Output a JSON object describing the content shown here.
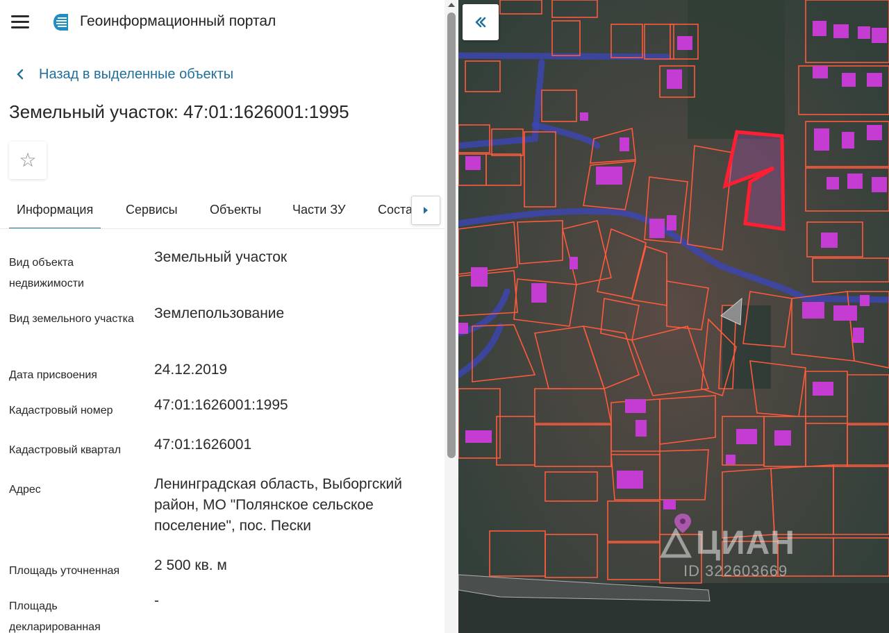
{
  "header": {
    "title": "Геоинформационный портал",
    "menu_icon": "hamburger-menu-icon",
    "logo_icon": "portal-logo-icon"
  },
  "back_link": {
    "label": "Назад в выделенные объекты",
    "icon": "chevron-left-icon"
  },
  "object_title": "Земельный участок: 47:01:1626001:1995",
  "favorite_icon": "star-outline-icon",
  "tabs": [
    {
      "label": "Информация",
      "active": true
    },
    {
      "label": "Сервисы",
      "active": false
    },
    {
      "label": "Объекты",
      "active": false
    },
    {
      "label": "Части ЗУ",
      "active": false
    },
    {
      "label": "Соста",
      "active": false
    }
  ],
  "tab_scroll_icon": "caret-right-icon",
  "properties": [
    {
      "label": "Вид объекта недвижимости",
      "value": "Земельный участок"
    },
    {
      "label": "Вид земельного участка",
      "value": "Землепользование"
    },
    {
      "label": "Дата присвоения",
      "value": "24.12.2019"
    },
    {
      "label": "Кадастровый номер",
      "value": "47:01:1626001:1995"
    },
    {
      "label": "Кадастровый квартал",
      "value": "47:01:1626001"
    },
    {
      "label": "Адрес",
      "value": "Ленинградская область, Выборгский район, МО \"Полянское сельское поселение\", пос. Пески"
    },
    {
      "label": "Площадь уточненная",
      "value": "2 500 кв. м"
    },
    {
      "label": "Площадь декларированная",
      "value": "-"
    }
  ],
  "map": {
    "collapse_icon": "double-chevron-left-icon",
    "watermark_brand": "ЦИАН",
    "watermark_id": "ID 322603669",
    "parcel_color": "#ff5a3c",
    "selected_color": "#ff1e32",
    "building_color": "#c43cd2",
    "road_color": "#3c46b4"
  },
  "colors": {
    "accent": "#1f6f9a",
    "text": "#262626"
  }
}
